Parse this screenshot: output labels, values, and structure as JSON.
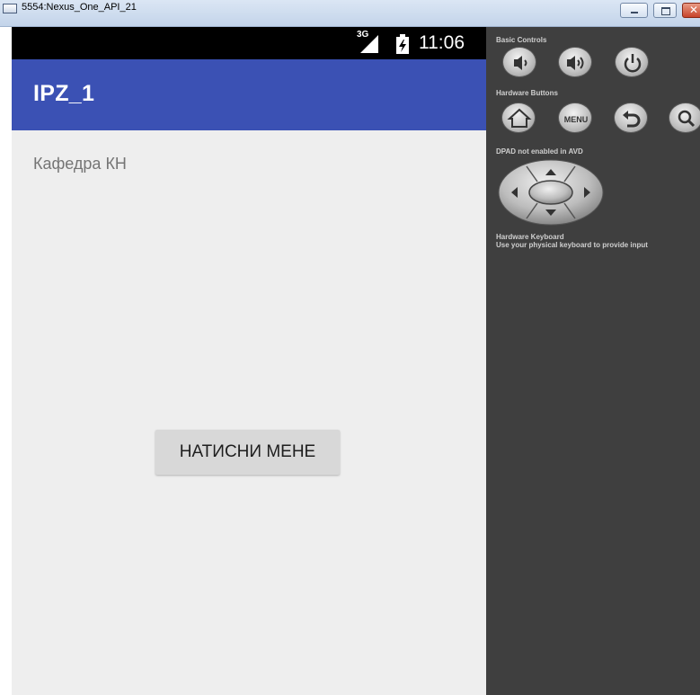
{
  "window": {
    "title": "5554:Nexus_One_API_21"
  },
  "status_bar": {
    "network_type": "3G",
    "time": "11:06"
  },
  "app": {
    "title": "IPZ_1",
    "label_text": "Кафедра КН",
    "button_label": "НАТИСНИ МЕНЕ"
  },
  "controls_panel": {
    "basic_controls_label": "Basic Controls",
    "hardware_buttons_label": "Hardware Buttons",
    "menu_button_label": "MENU",
    "dpad_label": "DPAD not enabled in AVD",
    "keyboard_label": "Hardware Keyboard",
    "keyboard_hint": "Use your physical keyboard to provide input"
  },
  "colors": {
    "app_bar": "#3b51b4",
    "screen_background": "#eeeeee",
    "panel_background": "#3f3f3f",
    "button_background": "#d8d8d8"
  }
}
